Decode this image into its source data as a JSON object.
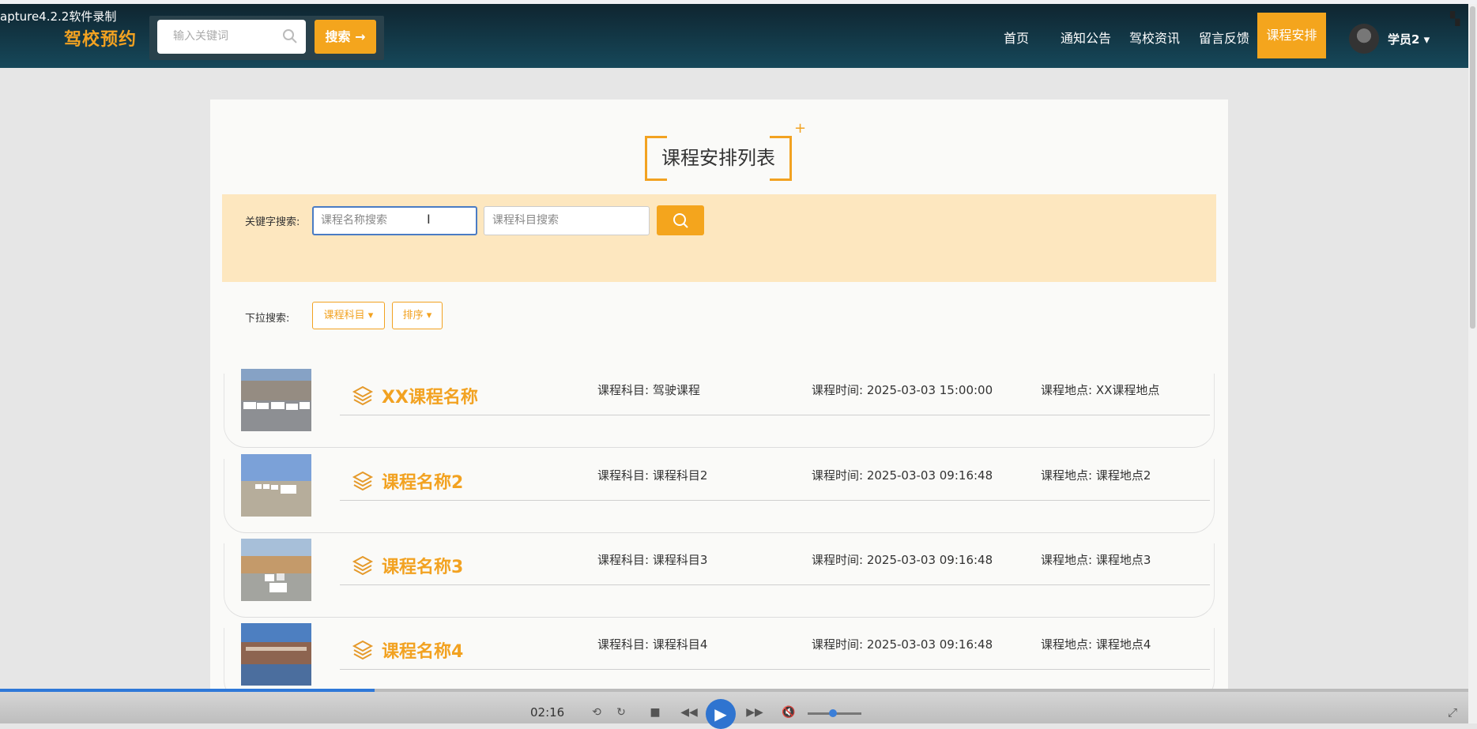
{
  "window": {
    "caption": "apture4.2.2软件录制"
  },
  "header": {
    "logo": "驾校预约",
    "search_placeholder": "输入关键词",
    "search_button": "搜索 →",
    "nav": [
      "首页",
      "通知公告",
      "驾校资讯",
      "留言反馈",
      "课程安排"
    ],
    "active_nav": "课程安排",
    "user": "学员2"
  },
  "page": {
    "title": "课程安排列表",
    "keyword_label": "关键字搜索:",
    "course_name_placeholder": "课程名称搜索",
    "course_subject_placeholder": "课程科目搜索",
    "dropdown_label": "下拉搜索:",
    "dropdowns": [
      "课程科目",
      "排序"
    ]
  },
  "courses": [
    {
      "name": "XX课程名称",
      "subject": "课程科目: 驾驶课程",
      "time": "课程时间: 2025-03-03 15:00:00",
      "location": "课程地点: XX课程地点"
    },
    {
      "name": "课程名称2",
      "subject": "课程科目: 课程科目2",
      "time": "课程时间: 2025-03-03 09:16:48",
      "location": "课程地点: 课程地点2"
    },
    {
      "name": "课程名称3",
      "subject": "课程科目: 课程科目3",
      "time": "课程时间: 2025-03-03 09:16:48",
      "location": "课程地点: 课程地点3"
    },
    {
      "name": "课程名称4",
      "subject": "课程科目: 课程科目4",
      "time": "课程时间: 2025-03-03 09:16:48",
      "location": "课程地点: 课程地点4"
    }
  ],
  "player": {
    "time": "02:16",
    "progress": 0.255
  },
  "colors": {
    "accent": "#f4a51d",
    "header": "#123846",
    "filter_band": "#fde7bf"
  }
}
